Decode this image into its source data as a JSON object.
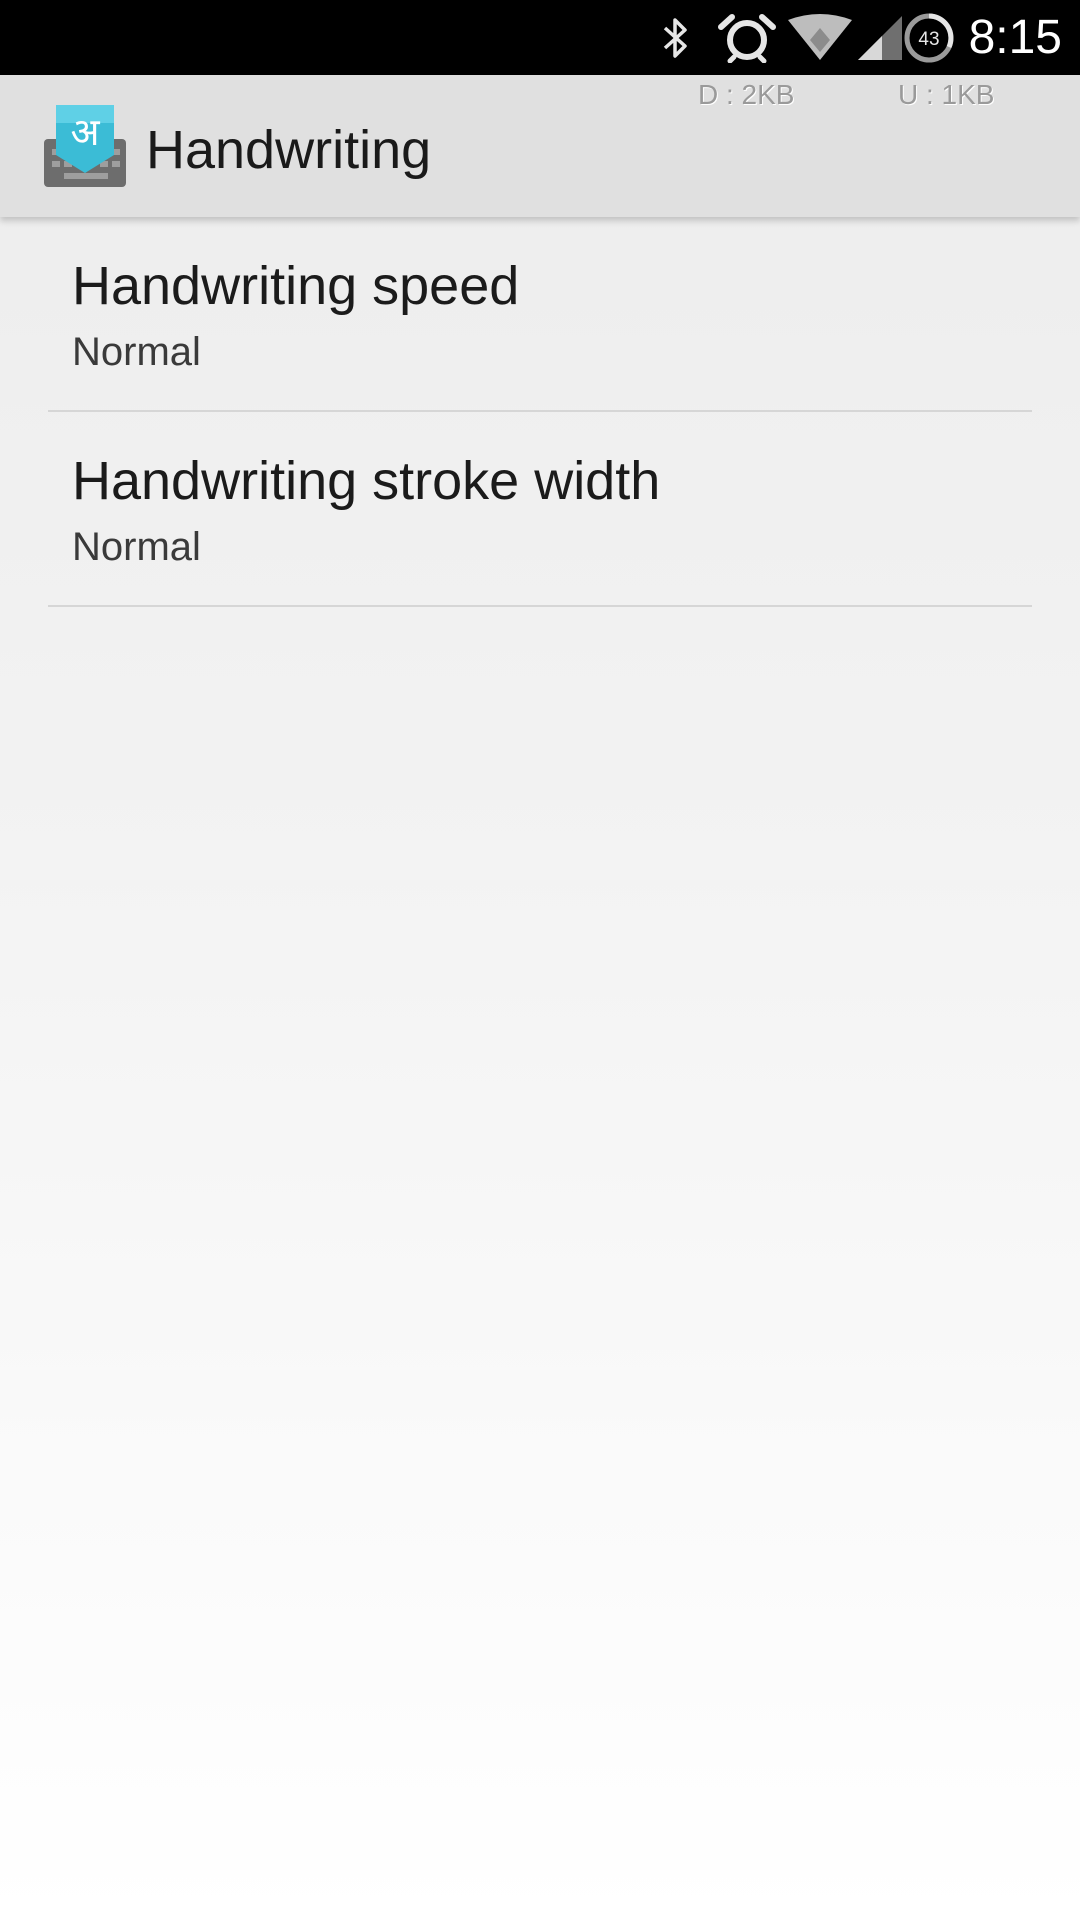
{
  "status_bar": {
    "time": "8:15",
    "battery_level": "43",
    "icons": [
      "bluetooth-icon",
      "alarm-icon",
      "wifi-icon",
      "cell-signal-icon",
      "battery-icon"
    ]
  },
  "app_bar": {
    "title": "Handwriting",
    "icon": "handwriting-keyboard-icon",
    "icon_glyph": "अ",
    "traffic_down": "D : 2KB",
    "traffic_up": "U : 1KB",
    "accent_color": "#3bbcd6"
  },
  "settings": [
    {
      "title": "Handwriting speed",
      "summary": "Normal"
    },
    {
      "title": "Handwriting stroke width",
      "summary": "Normal"
    }
  ]
}
